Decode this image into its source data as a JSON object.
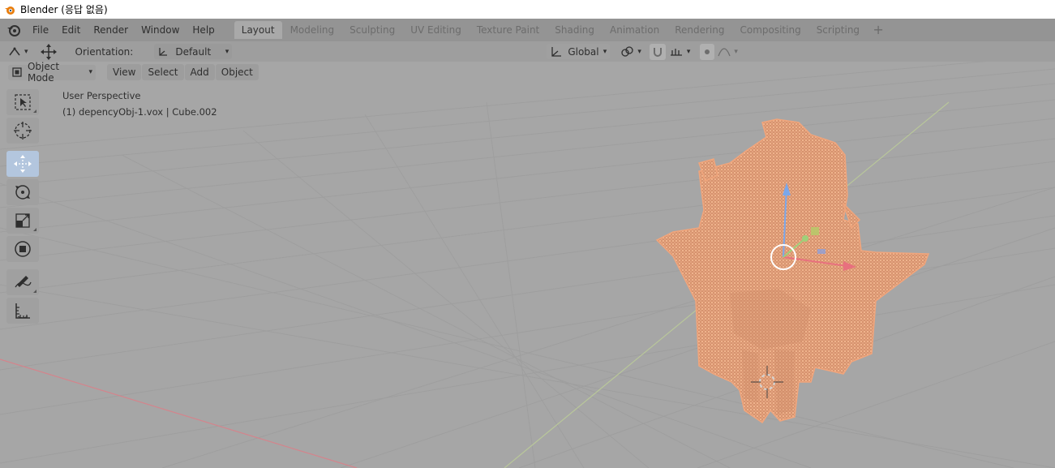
{
  "window": {
    "title": "Blender (응답 없음)"
  },
  "menu": [
    "File",
    "Edit",
    "Render",
    "Window",
    "Help"
  ],
  "workspaces": {
    "tabs": [
      "Layout",
      "Modeling",
      "Sculpting",
      "UV Editing",
      "Texture Paint",
      "Shading",
      "Animation",
      "Rendering",
      "Compositing",
      "Scripting"
    ],
    "active": "Layout",
    "add_label": "+"
  },
  "tool_header": {
    "orientation_label": "Orientation:",
    "orientation_value": "Default",
    "transform_orientation": "Global"
  },
  "view_header": {
    "mode": "Object Mode",
    "menus": [
      "View",
      "Select",
      "Add",
      "Object"
    ]
  },
  "viewport": {
    "perspective": "User Perspective",
    "object_info": "(1) depencyObj-1.vox | Cube.002"
  },
  "toolbar": {
    "tools": [
      "select-box",
      "cursor",
      "move",
      "rotate",
      "scale",
      "transform",
      "annotate",
      "measure"
    ],
    "active": "move"
  },
  "colors": {
    "viewport_bg": "#a6a6a6",
    "selection_orange": "#f0a57c",
    "x_axis": "#e8707e",
    "y_axis": "#9fd07a",
    "z_axis": "#7aa7ea"
  }
}
